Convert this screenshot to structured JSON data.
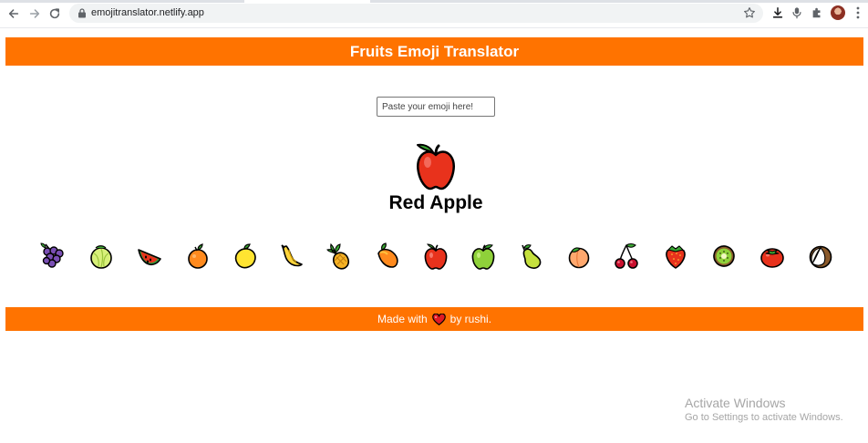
{
  "browser": {
    "url": "emojitranslator.netlify.app",
    "icons": [
      "back-icon",
      "forward-icon",
      "reload-icon",
      "lock-icon",
      "star-icon",
      "download-icon",
      "mic-icon",
      "extensions-icon",
      "avatar",
      "menu-icon"
    ]
  },
  "header": {
    "title": "Fruits Emoji Translator"
  },
  "input": {
    "placeholder": "Paste your emoji here!"
  },
  "output": {
    "emoji": "red-apple",
    "name": "Red Apple"
  },
  "fruits": [
    {
      "icon": "grapes-icon"
    },
    {
      "icon": "melon-icon"
    },
    {
      "icon": "watermelon-icon"
    },
    {
      "icon": "tangerine-icon"
    },
    {
      "icon": "lemon-icon"
    },
    {
      "icon": "banana-icon"
    },
    {
      "icon": "pineapple-icon"
    },
    {
      "icon": "mango-icon"
    },
    {
      "icon": "red-apple-icon"
    },
    {
      "icon": "green-apple-icon"
    },
    {
      "icon": "pear-icon"
    },
    {
      "icon": "peach-icon"
    },
    {
      "icon": "cherries-icon"
    },
    {
      "icon": "strawberry-icon"
    },
    {
      "icon": "kiwi-icon"
    },
    {
      "icon": "tomato-icon"
    },
    {
      "icon": "coconut-icon"
    }
  ],
  "footer": {
    "prefix": "Made with",
    "suffix": "by rushi."
  },
  "watermark": {
    "title": "Activate Windows",
    "subtitle": "Go to Settings to activate Windows."
  },
  "colors": {
    "accent": "#ff7300",
    "text_on_accent": "#ffffff"
  }
}
